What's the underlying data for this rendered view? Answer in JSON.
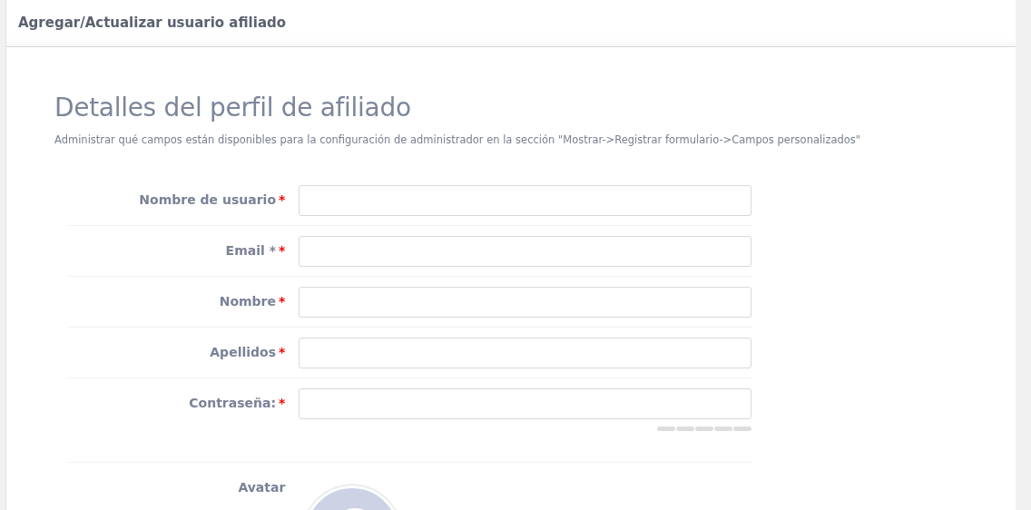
{
  "header": {
    "title": "Agregar/Actualizar usuario afiliado"
  },
  "section": {
    "title": "Detalles del perfil de afiliado",
    "description": "Administrar qué campos están disponibles para la configuración de administrador en la sección \"Mostrar->Registrar formulario->Campos personalizados\""
  },
  "fields": [
    {
      "label": "Nombre de usuario",
      "required_mark": "*",
      "kind": "text"
    },
    {
      "label": "Email *",
      "required_mark": "*",
      "kind": "text"
    },
    {
      "label": "Nombre",
      "required_mark": "*",
      "kind": "text"
    },
    {
      "label": "Apellidos",
      "required_mark": "*",
      "kind": "text"
    },
    {
      "label": "Contraseña:",
      "required_mark": "*",
      "kind": "password"
    },
    {
      "label": "Avatar",
      "kind": "avatar"
    }
  ]
}
